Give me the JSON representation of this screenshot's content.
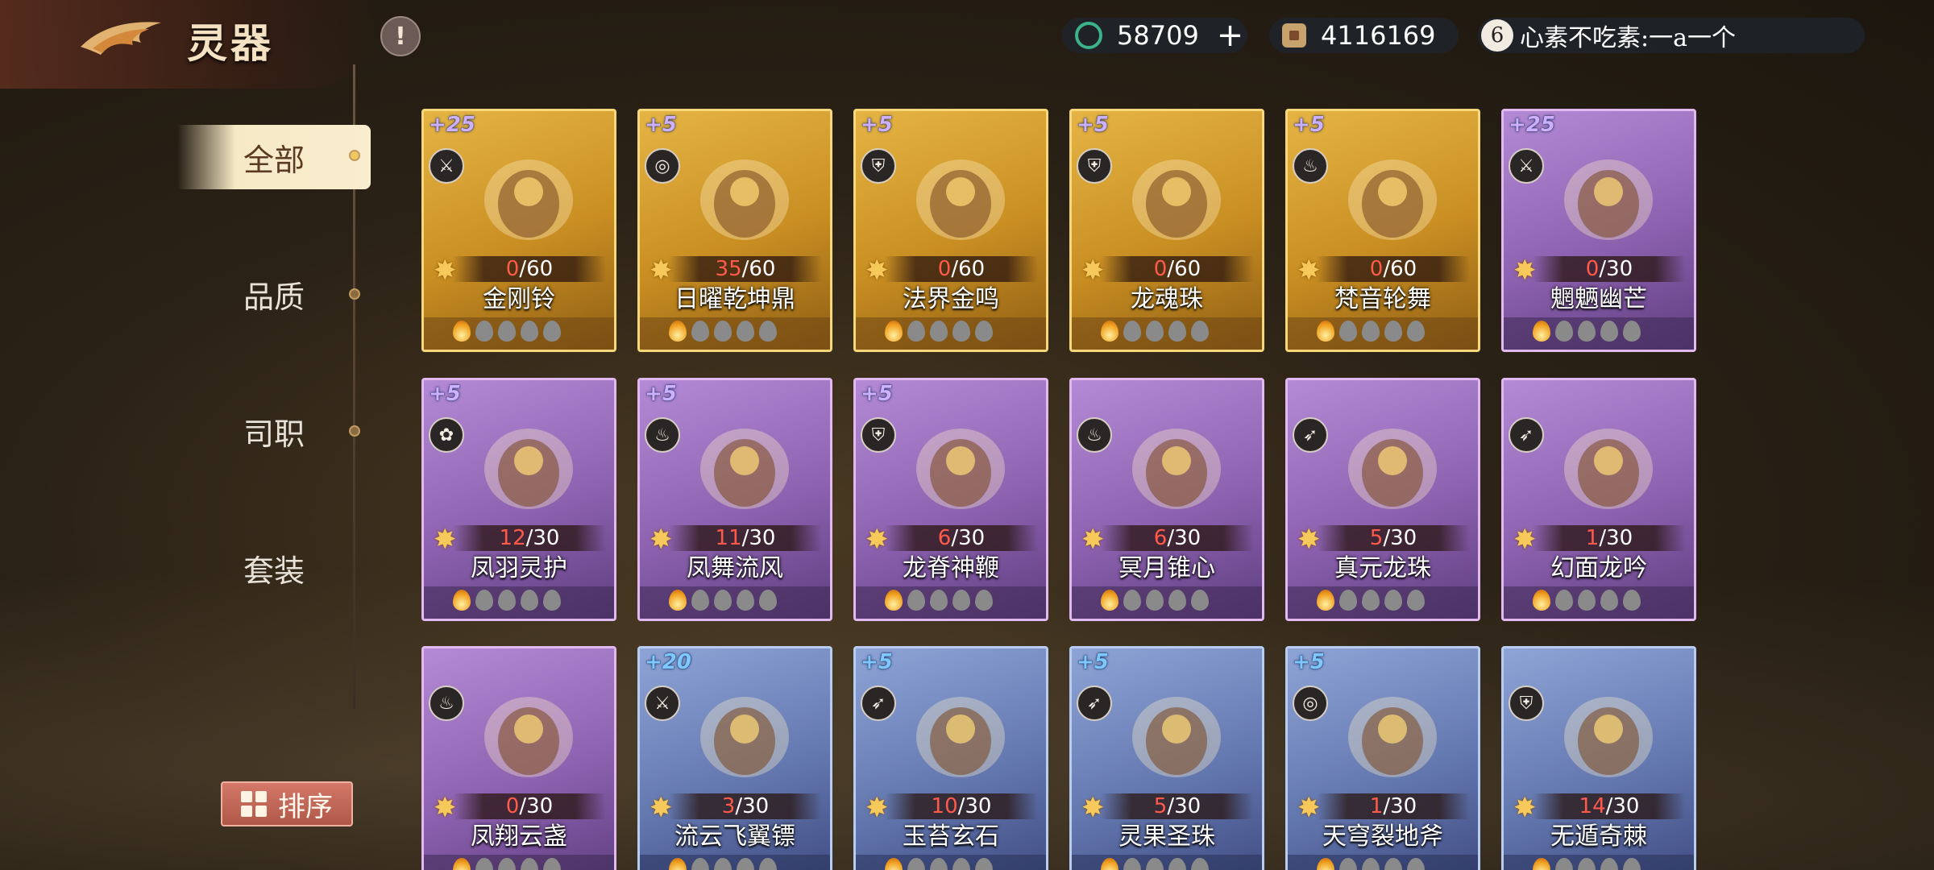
{
  "header": {
    "title": "灵器",
    "info_icon": "!"
  },
  "currency": {
    "jade": "58709",
    "plus": "+",
    "coin": "4116169",
    "user_level": "6",
    "user_name": "心素不吃素:一a一个"
  },
  "sidebar": {
    "items": [
      {
        "label": "全部",
        "active": true
      },
      {
        "label": "品质",
        "active": false
      },
      {
        "label": "司职",
        "active": false
      },
      {
        "label": "套装",
        "active": false
      }
    ],
    "sort_label": "排序"
  },
  "cards": [
    {
      "name": "金刚铃",
      "level": "+25",
      "current": "0",
      "max": "/60",
      "rarity": "gold",
      "class_icon": "blade-icon",
      "lit": 1
    },
    {
      "name": "日曜乾坤鼎",
      "level": "+5",
      "current": "35",
      "max": "/60",
      "rarity": "gold",
      "class_icon": "swirl-icon",
      "lit": 1
    },
    {
      "name": "法界金鸣",
      "level": "+5",
      "current": "0",
      "max": "/60",
      "rarity": "gold",
      "class_icon": "shield-icon",
      "lit": 1
    },
    {
      "name": "龙魂珠",
      "level": "+5",
      "current": "0",
      "max": "/60",
      "rarity": "gold",
      "class_icon": "shield-icon",
      "lit": 1
    },
    {
      "name": "梵音轮舞",
      "level": "+5",
      "current": "0",
      "max": "/60",
      "rarity": "gold",
      "class_icon": "gourd-icon",
      "lit": 1
    },
    {
      "name": "魍魉幽芒",
      "level": "+25",
      "current": "0",
      "max": "/30",
      "rarity": "purple",
      "class_icon": "blade-icon",
      "lit": 1
    },
    {
      "name": "凤羽灵护",
      "level": "+5",
      "current": "12",
      "max": "/30",
      "rarity": "purple",
      "class_icon": "lotus-icon",
      "lit": 1
    },
    {
      "name": "凤舞流风",
      "level": "+5",
      "current": "11",
      "max": "/30",
      "rarity": "purple",
      "class_icon": "gourd-icon",
      "lit": 1
    },
    {
      "name": "龙脊神鞭",
      "level": "+5",
      "current": "6",
      "max": "/30",
      "rarity": "purple",
      "class_icon": "shield-icon",
      "lit": 1
    },
    {
      "name": "冥月锥心",
      "level": "",
      "current": "6",
      "max": "/30",
      "rarity": "purple",
      "class_icon": "gourd-icon",
      "lit": 1
    },
    {
      "name": "真元龙珠",
      "level": "",
      "current": "5",
      "max": "/30",
      "rarity": "purple",
      "class_icon": "arrows-icon",
      "lit": 1
    },
    {
      "name": "幻面龙吟",
      "level": "",
      "current": "1",
      "max": "/30",
      "rarity": "purple",
      "class_icon": "arrows-icon",
      "lit": 1
    },
    {
      "name": "凤翔云盏",
      "level": "",
      "current": "0",
      "max": "/30",
      "rarity": "purple",
      "class_icon": "gourd-icon",
      "lit": 1
    },
    {
      "name": "流云飞翼镖",
      "level": "+20",
      "current": "3",
      "max": "/30",
      "rarity": "blue",
      "class_icon": "blade-icon",
      "lit": 1
    },
    {
      "name": "玉苔玄石",
      "level": "+5",
      "current": "10",
      "max": "/30",
      "rarity": "blue",
      "class_icon": "arrows-icon",
      "lit": 1
    },
    {
      "name": "灵果圣珠",
      "level": "+5",
      "current": "5",
      "max": "/30",
      "rarity": "blue",
      "class_icon": "arrows-icon",
      "lit": 1
    },
    {
      "name": "天穹裂地斧",
      "level": "+5",
      "current": "1",
      "max": "/30",
      "rarity": "blue",
      "class_icon": "swirl-icon",
      "lit": 1
    },
    {
      "name": "无遁奇棘",
      "level": "",
      "current": "14",
      "max": "/30",
      "rarity": "blue",
      "class_icon": "shield-icon",
      "lit": 1
    }
  ],
  "colors": {
    "gold": "#e5b444",
    "purple": "#8d62b0",
    "blue": "#6478b0",
    "progress_current": "#ff5a4a"
  }
}
